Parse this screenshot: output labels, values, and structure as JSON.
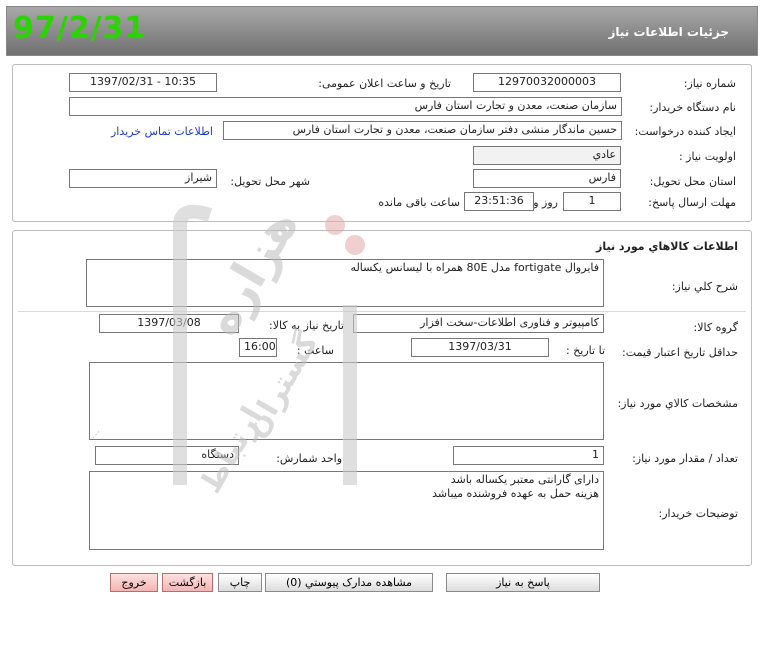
{
  "header": {
    "date_stamp": "97/2/31",
    "title": "جزئیات اطلاعات نیاز"
  },
  "details": {
    "need_number_label": "شماره نیاز:",
    "need_number_value": "12970032000003",
    "announce_label": "تاریخ و ساعت اعلان عمومی:",
    "announce_value": "1397/02/31 - 10:35",
    "buyer_org_label": "نام دستگاه خریدار:",
    "buyer_org_value": "سازمان صنعت، معدن و تجارت استان فارس",
    "requester_label": "ایجاد کننده درخواست:",
    "requester_value": "حسین ماندگار منشی دفتر  سازمان صنعت، معدن و تجارت استان فارس",
    "contact_link": "اطلاعات تماس خریدار",
    "priority_label": "اولویت نیاز :",
    "priority_value": "عادي",
    "province_label": "استان محل تحویل:",
    "province_value": "فارس",
    "city_label": "شهر محل تحویل:",
    "city_value": "شیراز",
    "deadline_label": "مهلت ارسال پاسخ:",
    "deadline_days": "1",
    "deadline_days_unit": "روز و",
    "deadline_time": "23:51:36",
    "deadline_remaining": "ساعت باقی مانده"
  },
  "goods": {
    "section_title": "اطلاعات کالاهاي مورد نیاز",
    "summary_label": "شرح کلي نیاز:",
    "summary_value": "فایروال fortigate مدل 80E همراه با لیسانس یکساله",
    "group_label": "گروه کالا:",
    "group_value": "کامپیوتر و فناوری اطلاعات-سخت افزار",
    "need_date_label": "تاریخ نیاز به کالا:",
    "need_date_value": "1397/03/08",
    "min_price_label": "حداقل تاریخ اعتبار قیمت:",
    "until_date_label": "تا تاریخ :",
    "until_date_value": "1397/03/31",
    "time_label": "ساعت :",
    "time_value": "16:00",
    "specs_label": "مشخصات کالاي مورد نیاز:",
    "specs_value": "",
    "qty_label": "تعداد / مقدار مورد نیاز:",
    "qty_value": "1",
    "unit_label": "واحد شمارش:",
    "unit_value": "دستگاه",
    "buyer_notes_label": "توضیحات خریدار:",
    "buyer_notes_line1": "دارای گارانتی معتبر یکساله باشد",
    "buyer_notes_line2": "هزینه حمل به عهده فروشنده میباشد"
  },
  "buttons": {
    "reply": "پاسخ به نیاز",
    "attachments": "مشاهده مدارک پیوستي (0)",
    "print": "چاپ",
    "back": "بازگشت",
    "exit": "خروج"
  },
  "watermark_text": [
    "هزاره",
    "گستران",
    "ارتباط"
  ]
}
